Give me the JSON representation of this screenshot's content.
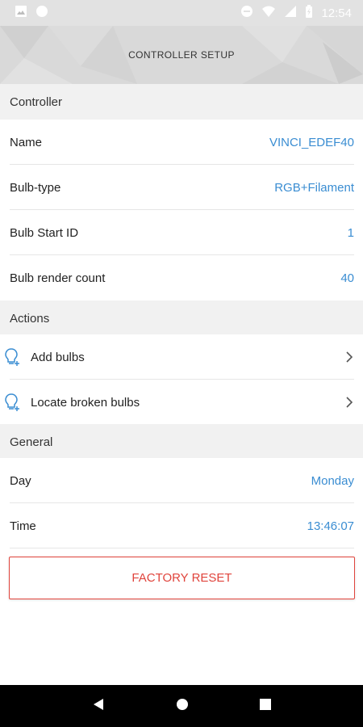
{
  "status_bar": {
    "time": "12:54",
    "icons": [
      "image-icon",
      "circle-icon",
      "dnd-icon",
      "wifi-icon",
      "signal-icon",
      "battery-icon"
    ]
  },
  "header": {
    "title": "CONTROLLER SETUP"
  },
  "sections": {
    "controller": {
      "title": "Controller",
      "rows": [
        {
          "label": "Name",
          "value": "VINCI_EDEF40"
        },
        {
          "label": "Bulb-type",
          "value": "RGB+Filament"
        },
        {
          "label": "Bulb Start ID",
          "value": "1"
        },
        {
          "label": "Bulb render count",
          "value": "40"
        }
      ]
    },
    "actions": {
      "title": "Actions",
      "items": [
        {
          "label": "Add bulbs",
          "icon": "bulb-add-icon"
        },
        {
          "label": "Locate broken bulbs",
          "icon": "bulb-add-icon"
        }
      ]
    },
    "general": {
      "title": "General",
      "rows": [
        {
          "label": "Day",
          "value": "Monday"
        },
        {
          "label": "Time",
          "value": "13:46:07"
        }
      ]
    }
  },
  "factory_reset": {
    "label": "FACTORY RESET"
  },
  "colors": {
    "accent": "#3a8dd2",
    "danger": "#e0443c",
    "section_bg": "#f1f1f1"
  },
  "nav_bar": {
    "icons": [
      "back-icon",
      "home-icon",
      "recents-icon"
    ]
  }
}
